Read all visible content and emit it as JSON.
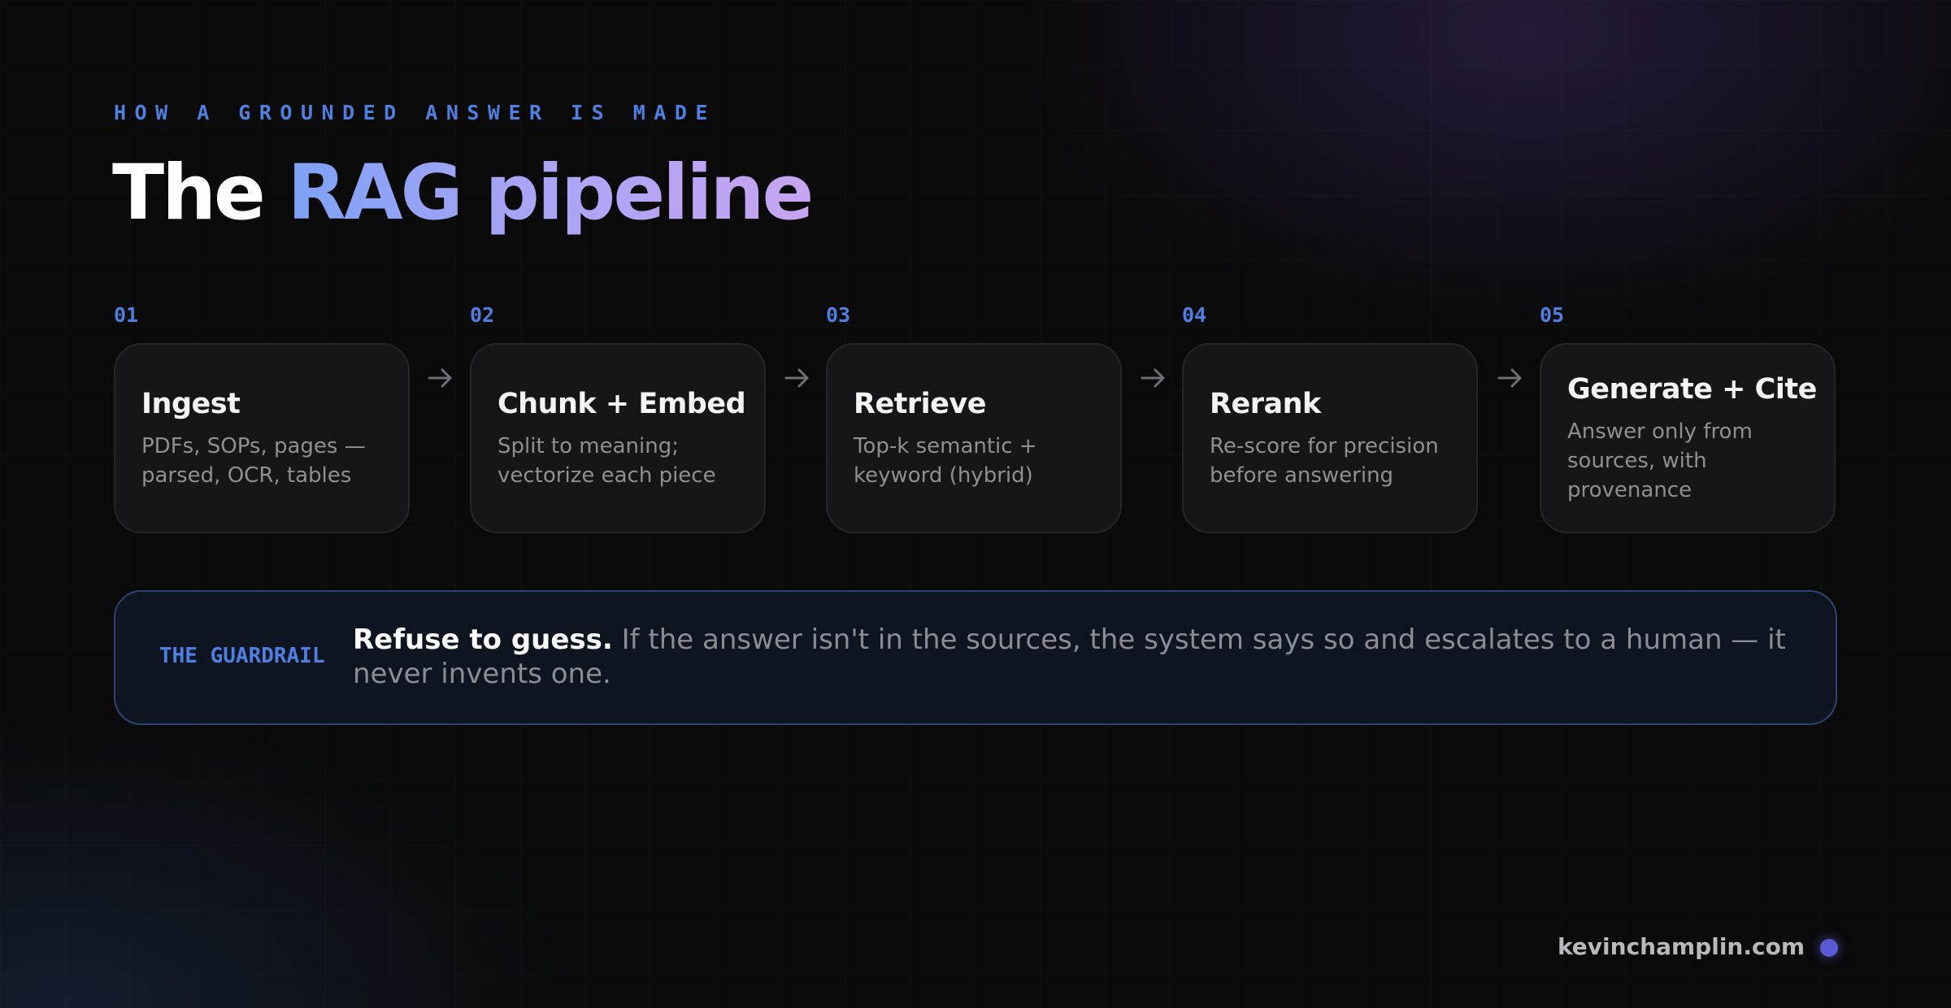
{
  "eyebrow": "HOW A GROUNDED ANSWER IS MADE",
  "title": {
    "plain": "The ",
    "accent": "RAG pipeline"
  },
  "steps": [
    {
      "num": "01",
      "title": "Ingest",
      "desc": "PDFs, SOPs, pages — parsed, OCR, tables"
    },
    {
      "num": "02",
      "title": "Chunk + Embed",
      "desc": "Split to meaning; vectorize each piece"
    },
    {
      "num": "03",
      "title": "Retrieve",
      "desc": "Top-k semantic + keyword (hybrid)"
    },
    {
      "num": "04",
      "title": "Rerank",
      "desc": "Re-score for precision before answering"
    },
    {
      "num": "05",
      "title": "Generate + Cite",
      "desc": "Answer only from sources, with provenance"
    }
  ],
  "guardrail": {
    "label": "THE GUARDRAIL",
    "bold": "Refuse to guess.",
    "text": " If the answer isn't in the sources, the system says so and escalates to a human — it never invents one."
  },
  "footer": {
    "url": "kevinchamplin.com"
  },
  "colors": {
    "accent_blue": "#4f7fe0",
    "gradient_start": "#7da2f5",
    "gradient_end": "#c7a5f2",
    "dot": "#5a5ad6"
  }
}
